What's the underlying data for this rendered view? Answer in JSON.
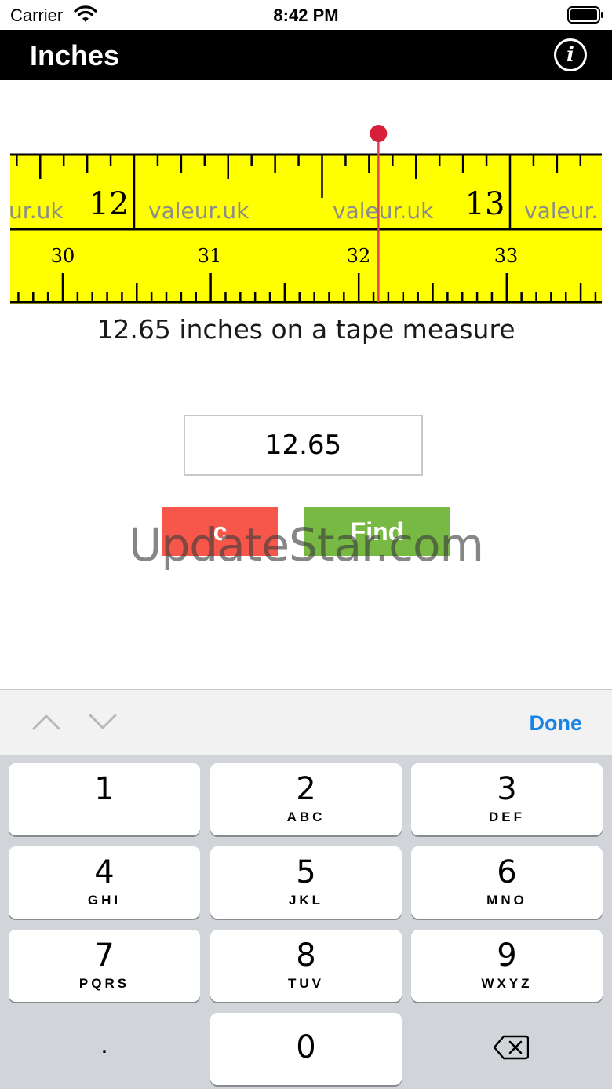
{
  "status_bar": {
    "carrier": "Carrier",
    "time": "8:42 PM",
    "icons": [
      "wifi-icon",
      "battery-icon"
    ]
  },
  "nav": {
    "title": "Inches",
    "info_glyph": "i"
  },
  "tape": {
    "inch_labels": [
      "12",
      "13"
    ],
    "cm_labels": [
      "30",
      "31",
      "32",
      "33"
    ],
    "brand_labels": [
      "ur.uk",
      "valeur.uk",
      "valeur.uk",
      "valeur."
    ],
    "marker_value_inches": 12.65,
    "colors": {
      "tape": "#ffff00",
      "marker": "#d81f3a",
      "ink": "#000000"
    }
  },
  "caption": "12.65 inches on a tape measure",
  "input": {
    "value": "12.65"
  },
  "buttons": {
    "clear_label": "c",
    "find_label": "Find",
    "clear_color": "#f7574a",
    "find_color": "#78b943"
  },
  "watermark": "UpdateStar.com",
  "keyboard": {
    "done_label": "Done",
    "toolbar_icons": [
      "chevron-up-icon",
      "chevron-down-icon"
    ],
    "keys": [
      {
        "digit": "1",
        "letters": ""
      },
      {
        "digit": "2",
        "letters": "ABC"
      },
      {
        "digit": "3",
        "letters": "DEF"
      },
      {
        "digit": "4",
        "letters": "GHI"
      },
      {
        "digit": "5",
        "letters": "JKL"
      },
      {
        "digit": "6",
        "letters": "MNO"
      },
      {
        "digit": "7",
        "letters": "PQRS"
      },
      {
        "digit": "8",
        "letters": "TUV"
      },
      {
        "digit": "9",
        "letters": "WXYZ"
      },
      {
        "digit": "0",
        "letters": ""
      }
    ],
    "dot_label": ".",
    "delete_icon": "backspace-icon"
  }
}
